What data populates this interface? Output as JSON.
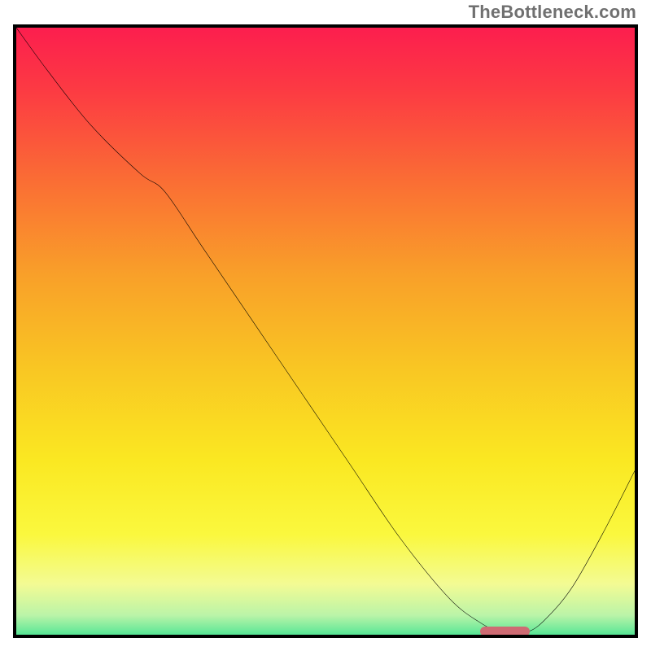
{
  "watermark": "TheBottleneck.com",
  "colors": {
    "border": "#000000",
    "curve": "#000000",
    "marker": "#ce6b73",
    "gradient_stops": [
      {
        "pos": 0.0,
        "color": "#fc1e4e"
      },
      {
        "pos": 0.1,
        "color": "#fc3a43"
      },
      {
        "pos": 0.25,
        "color": "#fa6e34"
      },
      {
        "pos": 0.4,
        "color": "#f9a029"
      },
      {
        "pos": 0.55,
        "color": "#f9c623"
      },
      {
        "pos": 0.7,
        "color": "#fae822"
      },
      {
        "pos": 0.82,
        "color": "#faf83e"
      },
      {
        "pos": 0.9,
        "color": "#f3fb94"
      },
      {
        "pos": 0.95,
        "color": "#bbf4a8"
      },
      {
        "pos": 0.975,
        "color": "#6de99a"
      },
      {
        "pos": 1.0,
        "color": "#12da84"
      }
    ]
  },
  "chart_data": {
    "type": "line",
    "title": "",
    "xlabel": "",
    "ylabel": "",
    "xlim": [
      0,
      100
    ],
    "ylim": [
      0,
      100
    ],
    "legend": false,
    "grid": false,
    "series": [
      {
        "name": "bottleneck-curve",
        "x": [
          0,
          5,
          12,
          20,
          24,
          30,
          38,
          46,
          54,
          62,
          70,
          75,
          78,
          80,
          83,
          86,
          90,
          95,
          100
        ],
        "y": [
          100,
          93,
          84,
          76,
          73,
          64,
          52,
          40,
          28,
          16,
          6,
          2,
          0.6,
          0.6,
          0.6,
          3,
          8,
          17,
          27
        ]
      }
    ],
    "marker": {
      "name": "optimal-range",
      "x_start": 75,
      "x_end": 83,
      "y": 0.6
    },
    "annotations": []
  }
}
